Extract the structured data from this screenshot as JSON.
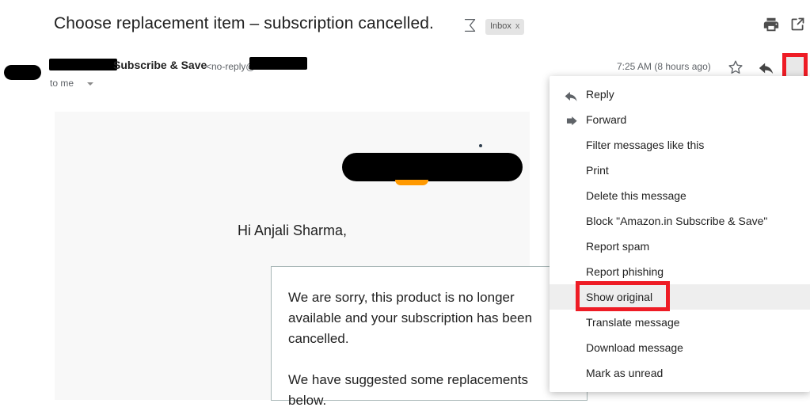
{
  "subject": {
    "text": "Choose replacement item – subscription cancelled.",
    "sigma_icon": "sigma-icon",
    "inbox_chip_label": "Inbox",
    "inbox_chip_close": "x",
    "print_icon": "print-icon",
    "popout_icon": "open-in-new-icon"
  },
  "sender": {
    "name": "Subscribe & Save",
    "email_prefix": "<no-reply@",
    "recipient": "to me",
    "timestamp": "7:25 AM (8 hours ago)",
    "star_icon": "star-icon",
    "reply_icon": "reply-arrow-icon",
    "more_icon": "more-vert-icon",
    "avatar": "avatar-redaction"
  },
  "body": {
    "greeting": "Hi Anjali Sharma,",
    "paragraph_1": "We are sorry, this product is no longer available and your subscription has been cancelled.",
    "paragraph_2": "We have suggested some replacements below."
  },
  "menu": {
    "items": [
      {
        "label": "Reply",
        "icon": "reply-arrow-icon",
        "hovered": false,
        "highlighted": false
      },
      {
        "label": "Forward",
        "icon": "forward-arrow-icon",
        "hovered": false,
        "highlighted": false
      },
      {
        "label": "Filter messages like this",
        "icon": "",
        "hovered": false,
        "highlighted": false
      },
      {
        "label": "Print",
        "icon": "",
        "hovered": false,
        "highlighted": false
      },
      {
        "label": "Delete this message",
        "icon": "",
        "hovered": false,
        "highlighted": false
      },
      {
        "label": "Block \"Amazon.in Subscribe & Save\"",
        "icon": "",
        "hovered": false,
        "highlighted": false
      },
      {
        "label": "Report spam",
        "icon": "",
        "hovered": false,
        "highlighted": false
      },
      {
        "label": "Report phishing",
        "icon": "",
        "hovered": false,
        "highlighted": false
      },
      {
        "label": "Show original",
        "icon": "",
        "hovered": true,
        "highlighted": true
      },
      {
        "label": "Translate message",
        "icon": "",
        "hovered": false,
        "highlighted": false
      },
      {
        "label": "Download message",
        "icon": "",
        "hovered": false,
        "highlighted": false
      },
      {
        "label": "Mark as unread",
        "icon": "",
        "hovered": false,
        "highlighted": false
      }
    ]
  },
  "colors": {
    "highlight_red": "#ee1c25",
    "amazon_orange": "#ff9900",
    "body_background": "#f8f8f8",
    "hover_gray": "#eeeeee"
  }
}
